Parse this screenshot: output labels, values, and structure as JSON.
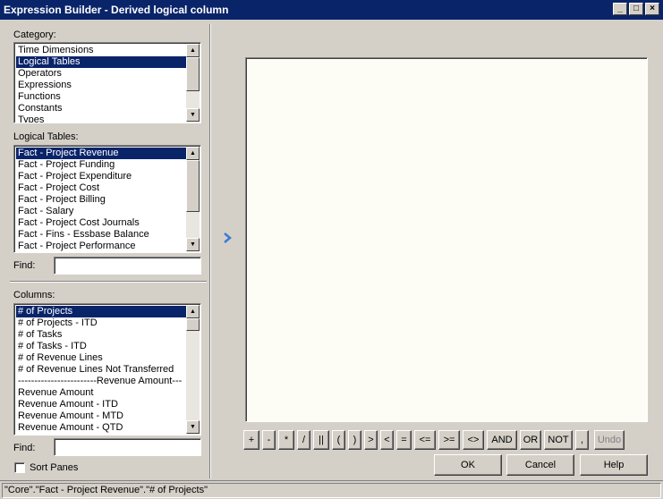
{
  "window": {
    "title": "Expression Builder - Derived logical column",
    "minimize": "_",
    "maximize": "□",
    "close": "×"
  },
  "category": {
    "label": "Category:",
    "items": [
      "Time Dimensions",
      "Logical Tables",
      "Operators",
      "Expressions",
      "Functions",
      "Constants",
      "Types"
    ],
    "selected_index": 1
  },
  "logical_tables": {
    "label": "Logical Tables:",
    "items": [
      "Fact - Project Revenue",
      "Fact - Project Funding",
      "Fact - Project Expenditure",
      "Fact - Project Cost",
      "Fact - Project Billing",
      "Fact - Salary",
      "Fact - Project Cost Journals",
      "Fact - Fins - Essbase Balance",
      "Fact - Project Performance"
    ],
    "selected_index": 0
  },
  "find1": {
    "label": "Find:",
    "value": ""
  },
  "columns": {
    "label": "Columns:",
    "items": [
      "# of Projects",
      "# of Projects - ITD",
      "# of Tasks",
      "# of Tasks - ITD",
      "# of Revenue Lines",
      "# of Revenue Lines Not Transferred",
      "------------------------Revenue Amount---",
      "Revenue Amount",
      "Revenue Amount - ITD",
      "Revenue Amount - MTD",
      "Revenue Amount - QTD"
    ],
    "selected_index": 0
  },
  "find2": {
    "label": "Find:",
    "value": ""
  },
  "sort_panes": {
    "label": "Sort Panes",
    "checked": false
  },
  "operators": [
    "+",
    "-",
    "*",
    "/",
    "||",
    "(",
    ")",
    ">",
    "<",
    "=",
    "<=",
    ">=",
    "<>",
    "AND",
    "OR",
    "NOT",
    ","
  ],
  "undo_label": "Undo",
  "ok_label": "OK",
  "cancel_label": "Cancel",
  "help_label": "Help",
  "status_text": "\"Core\".\"Fact - Project Revenue\".\"# of Projects\"",
  "colors": {
    "titlebar": "#0a246a",
    "selection": "#0a246a",
    "editor_bg": "#fefdf5",
    "arrow": "#3a7bd5"
  }
}
